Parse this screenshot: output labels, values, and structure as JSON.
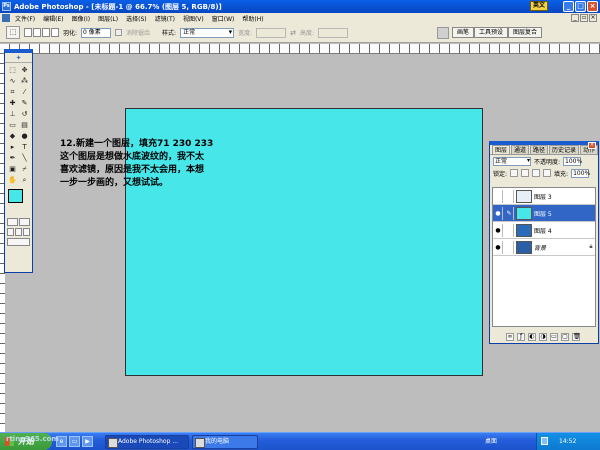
{
  "window": {
    "title": "Adobe Photoshop - [未标题-1 @ 66.7% (图层 5, RGB/8)]",
    "ime": "英文"
  },
  "menu": [
    "文件(F)",
    "编辑(E)",
    "图像(I)",
    "图层(L)",
    "选择(S)",
    "滤镜(T)",
    "视图(V)",
    "窗口(W)",
    "帮助(H)"
  ],
  "options": {
    "feather_label": "羽化:",
    "feather_value": "0 像素",
    "antialias_label": "消除锯齿",
    "style_label": "样式:",
    "style_value": "正常",
    "width_label": "宽度:",
    "height_label": "高度:"
  },
  "palette_well": {
    "tabs": [
      "画笔",
      "工具预设",
      "图层复合"
    ]
  },
  "annotation": "12.新建一个图层，填充71 230 233\n这个图层是想做水底波纹的，我不太\n喜欢滤镜，原因是我不太会用，本想\n一步一步画的，又想试试。",
  "colors": {
    "foreground": "#47e6e9",
    "background": "#ffffff",
    "canvas": "#47e6e9"
  },
  "layers_panel": {
    "tabs": [
      "图层",
      "通道",
      "路径",
      "历史记录",
      "动作"
    ],
    "blend_mode": "正常",
    "opacity_label": "不透明度:",
    "opacity_value": "100%",
    "lock_label": "锁定:",
    "fill_label": "填充:",
    "fill_value": "100%",
    "layers": [
      {
        "name": "图层 3",
        "visible": false,
        "selected": false,
        "thumb": "#e8eef6"
      },
      {
        "name": "图层 5",
        "visible": true,
        "selected": true,
        "thumb": "#47e6e9"
      },
      {
        "name": "图层 4",
        "visible": true,
        "selected": false,
        "thumb": "#2b6bb8"
      },
      {
        "name": "背景",
        "visible": true,
        "selected": false,
        "thumb": "#2a5fa8"
      }
    ]
  },
  "taskbar": {
    "start": "开始",
    "tasks": [
      "Adobe Photoshop ...",
      "我的电脑"
    ],
    "desktop": "桌面",
    "time": "14:52"
  },
  "watermark": "rting365.com"
}
